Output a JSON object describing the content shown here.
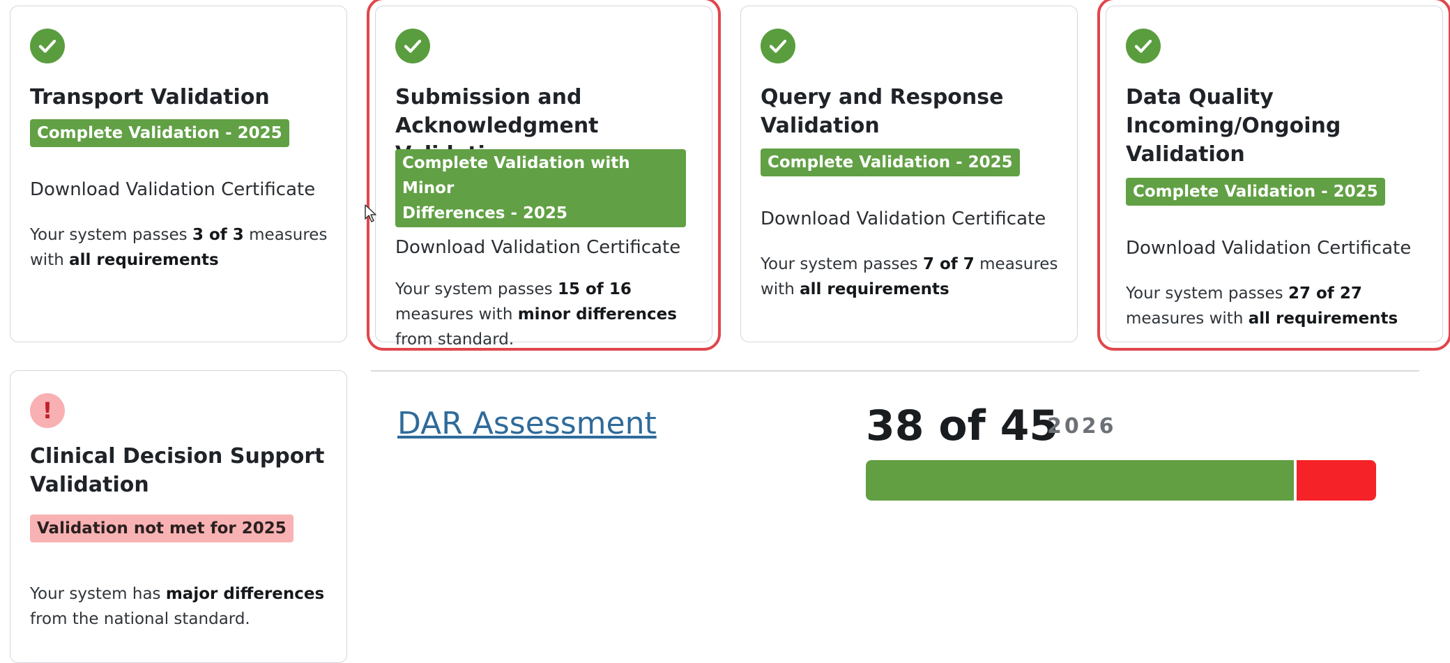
{
  "cards": [
    {
      "title_lines": [
        "Transport Validation"
      ],
      "badge": "Complete Validation - 2025",
      "certificate_link": "Download Validation Certificate",
      "desc_prefix": "Your system passes ",
      "desc_count": "3 of 3",
      "desc_middle": " measures with ",
      "desc_emph": "all requirements",
      "desc_suffix": ""
    },
    {
      "title_lines": [
        "Submission and",
        "Acknowledgment Validation"
      ],
      "badge_lines": [
        "Complete Validation with Minor",
        "Differences - 2025"
      ],
      "certificate_link": "Download Validation Certificate",
      "desc_prefix": "Your system passes ",
      "desc_count": "15 of 16",
      "desc_middle": " measures with ",
      "desc_emph": "minor differences",
      "desc_suffix": " from standard."
    },
    {
      "title_lines": [
        "Query and Response",
        "Validation"
      ],
      "badge": "Complete Validation - 2025",
      "certificate_link": "Download Validation Certificate",
      "desc_prefix": "Your system passes ",
      "desc_count": "7 of 7",
      "desc_middle": " measures with ",
      "desc_emph": "all requirements",
      "desc_suffix": ""
    },
    {
      "title_lines": [
        "Data Quality",
        "Incoming/Ongoing",
        "Validation"
      ],
      "badge": "Complete Validation - 2025",
      "certificate_link": "Download Validation Certificate",
      "desc_prefix": "Your system passes ",
      "desc_count": "27 of 27",
      "desc_middle": " measures with ",
      "desc_emph": "all requirements",
      "desc_suffix": ""
    },
    {
      "title_lines": [
        "Clinical Decision Support",
        "Validation"
      ],
      "badge": "Validation not met for 2025",
      "desc_prefix": "Your system has ",
      "desc_emph": "major differences",
      "desc_suffix": " from the national standard."
    }
  ],
  "dar": {
    "link_label": "DAR Assessment",
    "score_label": "38 of 45",
    "year": "2026",
    "passed": 38,
    "total": 45
  },
  "colors": {
    "pass_green": "#61a044",
    "fail_red": "#f52327",
    "highlight_red": "#e0474c",
    "link_blue": "#2f6b9a"
  }
}
